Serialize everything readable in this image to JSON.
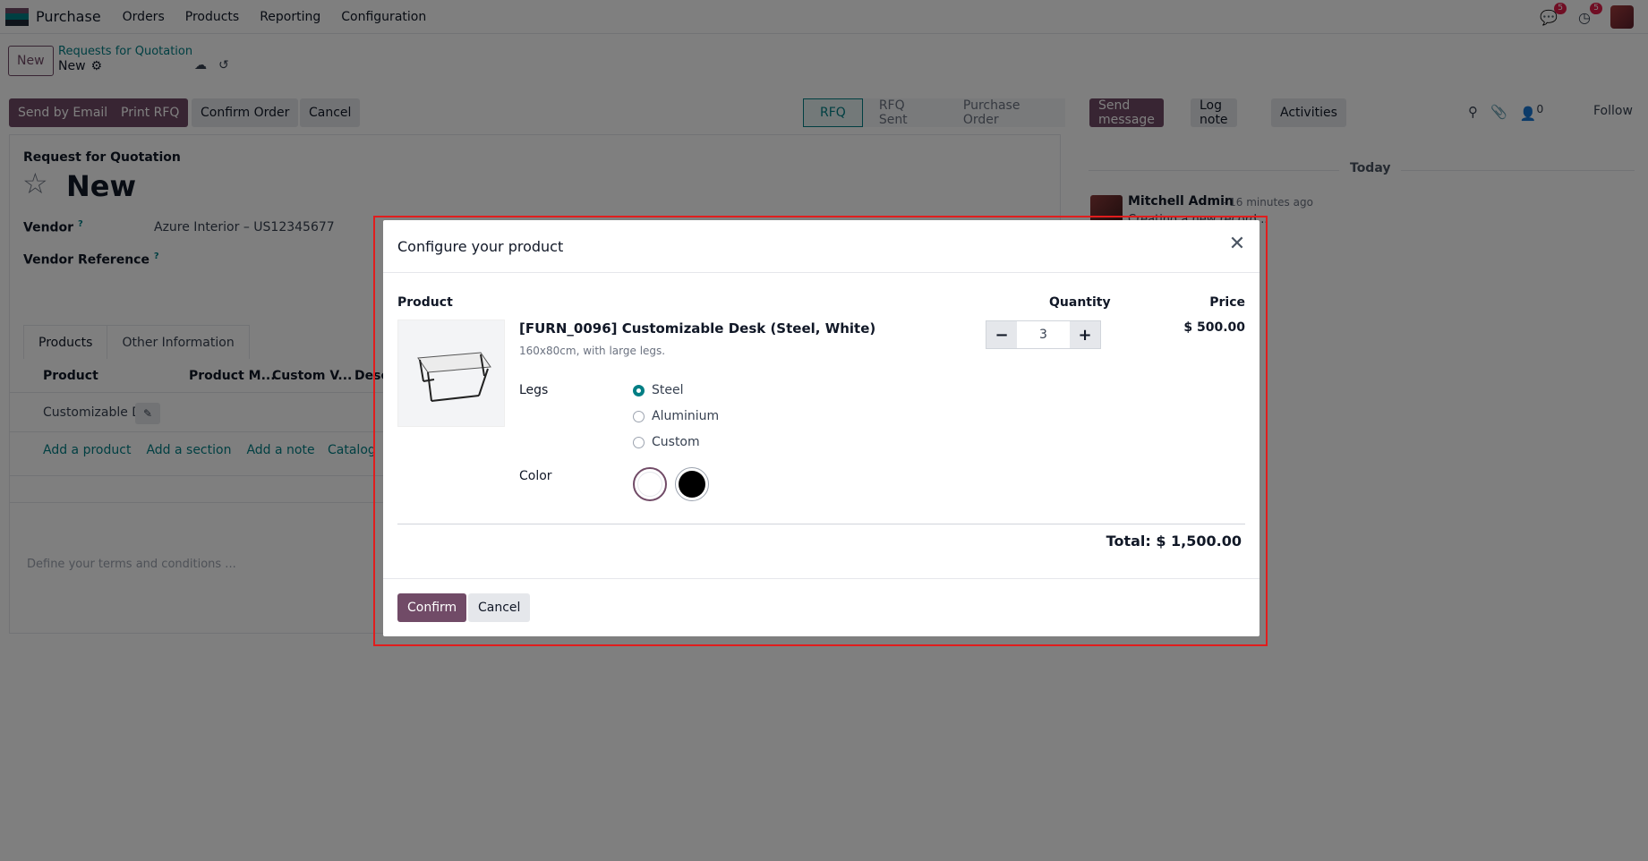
{
  "topnav": {
    "app_name": "Purchase",
    "menu": [
      "Orders",
      "Products",
      "Reporting",
      "Configuration"
    ],
    "messages_badge": "5",
    "activities_badge": "5",
    "logo_colors": [
      "#714B67",
      "#017e84",
      "#1f2937"
    ]
  },
  "control_panel": {
    "new_label": "New",
    "breadcrumb_parent": "Requests for Quotation",
    "breadcrumb_current": "New"
  },
  "actions": {
    "send_by_email": "Send by Email",
    "print_rfq": "Print RFQ",
    "confirm_order": "Confirm Order",
    "cancel": "Cancel"
  },
  "status_steps": [
    "RFQ",
    "RFQ Sent",
    "Purchase Order"
  ],
  "chatter": {
    "send_message": "Send message",
    "log_note": "Log note",
    "activities": "Activities",
    "follower_count": "0",
    "follow": "Follow",
    "today": "Today",
    "author": "Mitchell Admin",
    "time": "- 16 minutes ago",
    "body": "Creating a new record..."
  },
  "form": {
    "subtitle": "Request for Quotation",
    "title": "New",
    "vendor_label": "Vendor",
    "vendor_value": "Azure Interior – US12345677",
    "vendor_ref_label": "Vendor Reference",
    "tabs": [
      "Products",
      "Other Information"
    ],
    "columns": [
      "Product",
      "Product M...",
      "Custom V...",
      "Desc"
    ],
    "row_product": "Customizable De",
    "add_product": "Add a product",
    "add_section": "Add a section",
    "add_note": "Add a note",
    "catalog": "Catalog",
    "terms_placeholder": "Define your terms and conditions ..."
  },
  "dialog": {
    "title": "Configure your product",
    "col_product": "Product",
    "col_quantity": "Quantity",
    "col_price": "Price",
    "product_name": "[FURN_0096] Customizable Desk (Steel, White)",
    "product_description": "160x80cm, with large legs.",
    "legs_label": "Legs",
    "legs_options": [
      "Steel",
      "Aluminium",
      "Custom"
    ],
    "legs_selected": "Steel",
    "color_label": "Color",
    "color_swatches": [
      "#ffffff",
      "#000000"
    ],
    "quantity": "3",
    "price": "$ 500.00",
    "total": "Total: $ 1,500.00",
    "confirm": "Confirm",
    "cancel": "Cancel"
  }
}
